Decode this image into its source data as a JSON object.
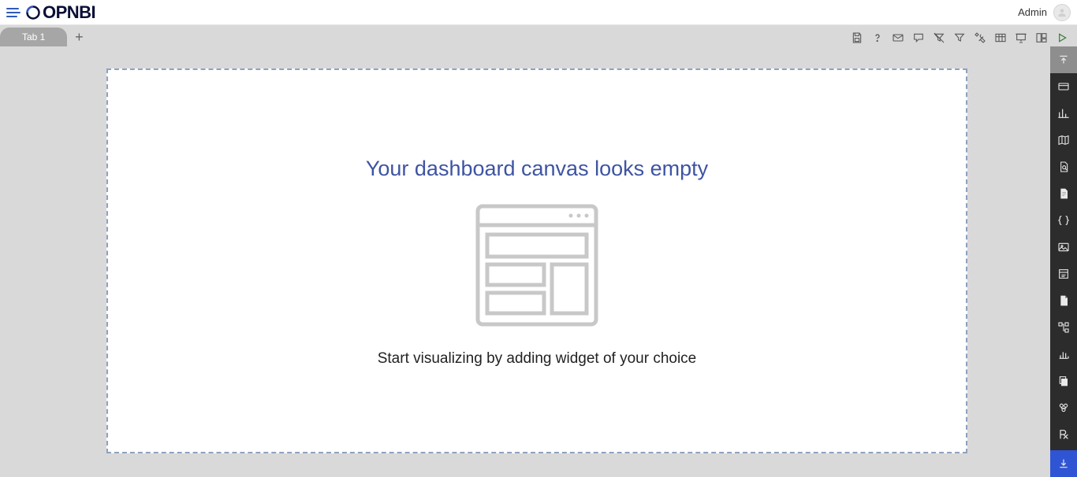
{
  "header": {
    "brand": "OPNBI",
    "user_label": "Admin"
  },
  "tabs": {
    "items": [
      {
        "label": "Tab 1"
      }
    ]
  },
  "toolbar": {
    "icons": [
      "save-icon",
      "help-icon",
      "mail-icon",
      "comment-icon",
      "filter-off-icon",
      "filter-icon",
      "tools-icon",
      "table-icon",
      "presentation-icon",
      "layout-icon",
      "play-icon"
    ]
  },
  "canvas": {
    "empty_title": "Your dashboard canvas looks empty",
    "empty_subtitle": "Start visualizing by adding widget of your choice"
  },
  "rightbar": {
    "items": [
      "collapse-up-icon",
      "card-icon",
      "chart-icon",
      "map-icon",
      "file-search-icon",
      "document-icon",
      "braces-icon",
      "image-icon",
      "form-icon",
      "file-icon",
      "tree-icon",
      "bar-chart-icon",
      "copy-icon",
      "group-icon",
      "rx-icon",
      "download-icon"
    ]
  }
}
